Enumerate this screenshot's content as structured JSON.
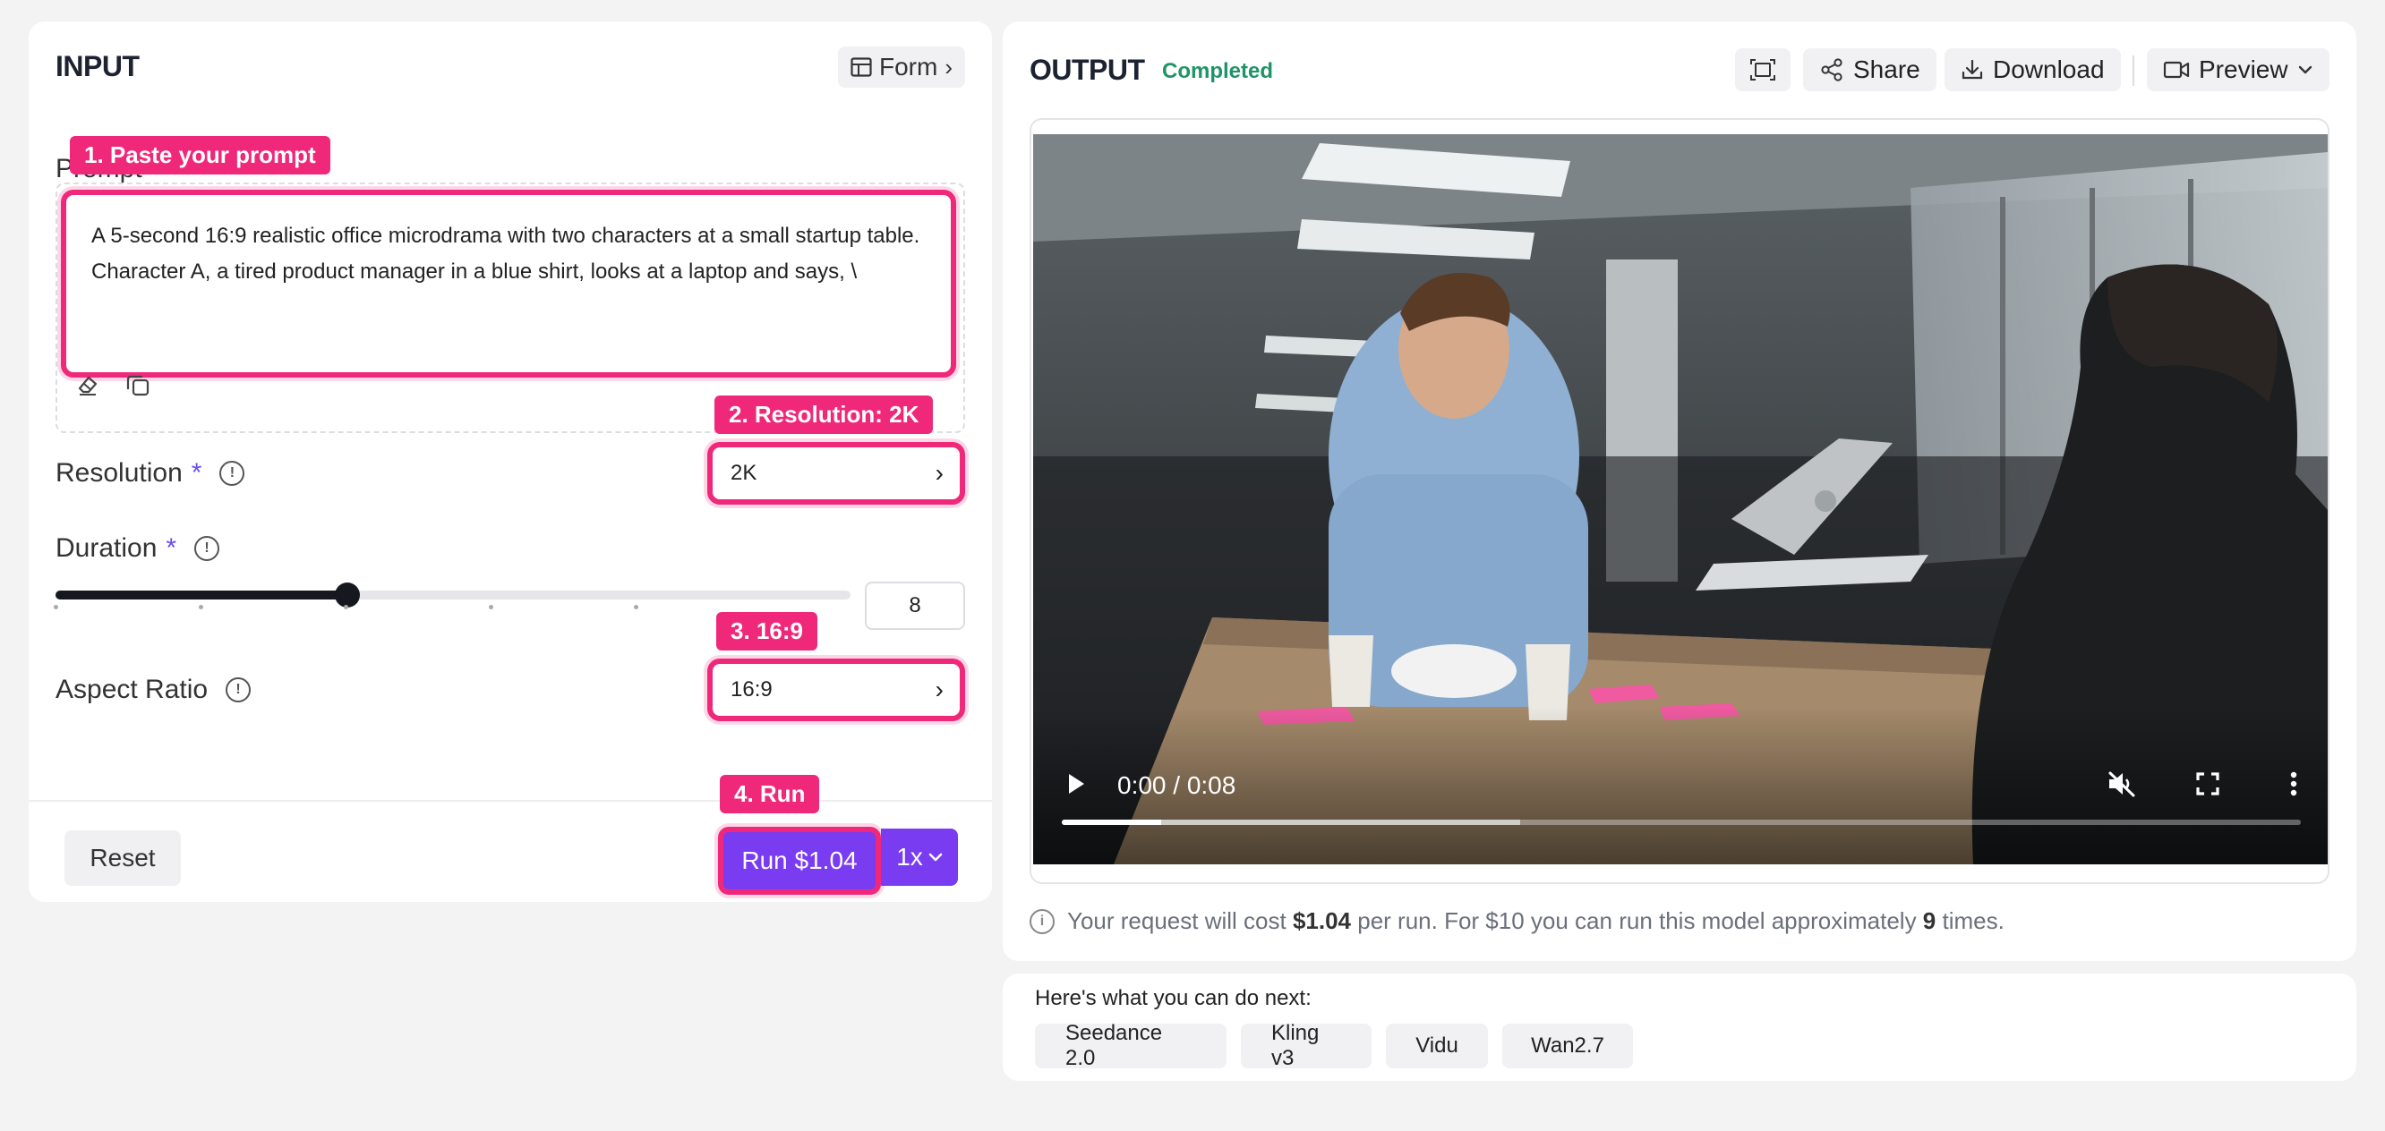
{
  "input": {
    "title": "INPUT",
    "form_label": "Form",
    "prompt_label": "Prompt",
    "prompt_text": "A 5-second 16:9 realistic office microdrama with two characters at a small startup table. Character A, a tired product manager in a blue shirt, looks at a laptop and says, \\",
    "callouts": {
      "prompt": "1. Paste your prompt",
      "resolution": "2. Resolution: 2K",
      "aspect": "3. 16:9",
      "run": "4. Run"
    },
    "resolution": {
      "label": "Resolution",
      "required": "*",
      "value": "2K"
    },
    "duration": {
      "label": "Duration",
      "required": "*",
      "value": "8",
      "slider_fraction": 0.36
    },
    "aspect_ratio": {
      "label": "Aspect Ratio",
      "value": "16:9"
    },
    "reset_label": "Reset",
    "run_label": "Run $1.04",
    "multiplier_label": "1x"
  },
  "output": {
    "title": "OUTPUT",
    "status": "Completed",
    "share_label": "Share",
    "download_label": "Download",
    "preview_label": "Preview",
    "video": {
      "time": "0:00 / 0:08",
      "played_fraction": 0.08,
      "buffered_fraction": 0.37
    },
    "cost": {
      "prefix": "Your request will cost ",
      "price": "$1.04",
      "middle": " per run. For $10 you can run this model approximately ",
      "count": "9",
      "suffix": " times."
    }
  },
  "next": {
    "title": "Here's what you can do next:",
    "chips": [
      "Seedance 2.0",
      "Kling v3",
      "Vidu",
      "Wan2.7"
    ]
  },
  "colors": {
    "accent": "#7a3cf0",
    "callout": "#f0287a",
    "status": "#1f9467"
  }
}
